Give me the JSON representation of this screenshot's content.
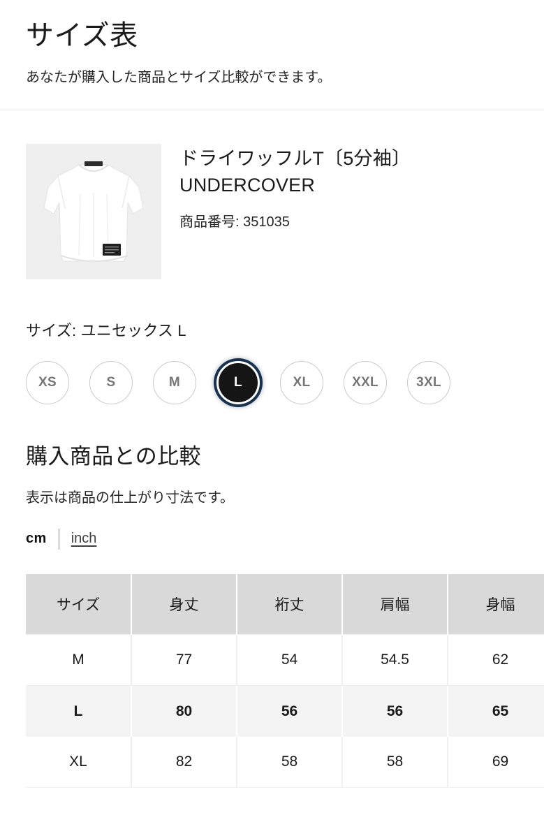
{
  "header": {
    "title": "サイズ表",
    "subtitle": "あなたが購入した商品とサイズ比較ができます。"
  },
  "product": {
    "image_alt": "white-tshirt-thumbnail",
    "name_line1": "ドライワッフルT〔5分袖〕",
    "name_line2": "UNDERCOVER",
    "code_label": "商品番号: 351035"
  },
  "size_selector": {
    "label": "サイズ: ユニセックス L",
    "selected": "L",
    "options": [
      {
        "label": "XS",
        "selected": false
      },
      {
        "label": "S",
        "selected": false
      },
      {
        "label": "M",
        "selected": false
      },
      {
        "label": "L",
        "selected": true
      },
      {
        "label": "XL",
        "selected": false
      },
      {
        "label": "XXL",
        "selected": false
      },
      {
        "label": "3XL",
        "selected": false
      }
    ]
  },
  "comparison": {
    "title": "購入商品との比較",
    "note": "表示は商品の仕上がり寸法です。",
    "unit_active": "cm",
    "unit_alternate": "inch"
  },
  "colors": {
    "selected_pill_bg": "#151515",
    "focus_ring": "#18314f",
    "table_header_bg": "#d9d9d9",
    "highlight_row_bg": "#f4f4f4",
    "pill_border": "#c9c9c9"
  },
  "chart_data": {
    "type": "table",
    "title": "購入商品との比較",
    "unit": "cm",
    "columns": [
      "サイズ",
      "身丈",
      "裄丈",
      "肩幅",
      "身幅"
    ],
    "highlight_row": "L",
    "rows": [
      {
        "size": "M",
        "values": [
          "77",
          "54",
          "54.5",
          "62"
        ]
      },
      {
        "size": "L",
        "values": [
          "80",
          "56",
          "56",
          "65"
        ]
      },
      {
        "size": "XL",
        "values": [
          "82",
          "58",
          "58",
          "69"
        ]
      }
    ]
  }
}
